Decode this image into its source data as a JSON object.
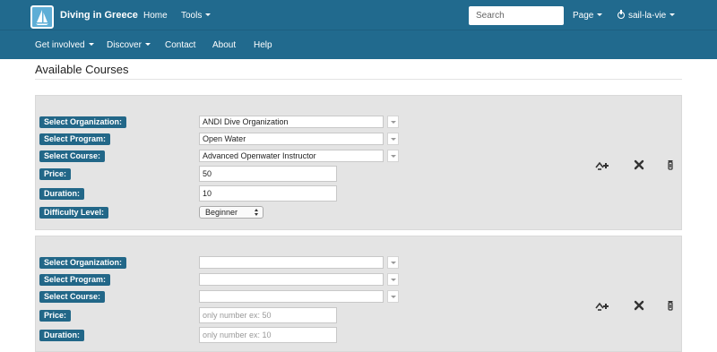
{
  "navbar": {
    "brand": "Diving in Greece",
    "home": "Home",
    "tools": "Tools",
    "search_placeholder": "Search",
    "page": "Page",
    "user": "sail-la-vie",
    "get_involved": "Get involved",
    "discover": "Discover",
    "contact": "Contact",
    "about": "About",
    "help": "Help"
  },
  "page": {
    "title": "Available Courses"
  },
  "labels": {
    "organization": "Select Organization:",
    "program": "Select Program:",
    "course": "Select Course:",
    "price": "Price:",
    "duration": "Duration:",
    "difficulty": "Difficulty Level:"
  },
  "course1": {
    "organization": "ANDI Dive Organization",
    "program": "Open Water",
    "course": "Advanced Openwater Instructor",
    "price": "50",
    "duration": "10",
    "difficulty": "Beginner"
  },
  "course2": {
    "organization": "",
    "program": "",
    "course": "",
    "price_placeholder": "only number ex: 50",
    "duration_placeholder": "only number ex: 10"
  },
  "icons": {
    "add": "add-course-icon",
    "remove": "remove-icon",
    "delete": "trash-icon"
  },
  "colors": {
    "navbar": "#216a8e",
    "label_bg": "#226788",
    "panel_bg": "#e4e4e4"
  }
}
